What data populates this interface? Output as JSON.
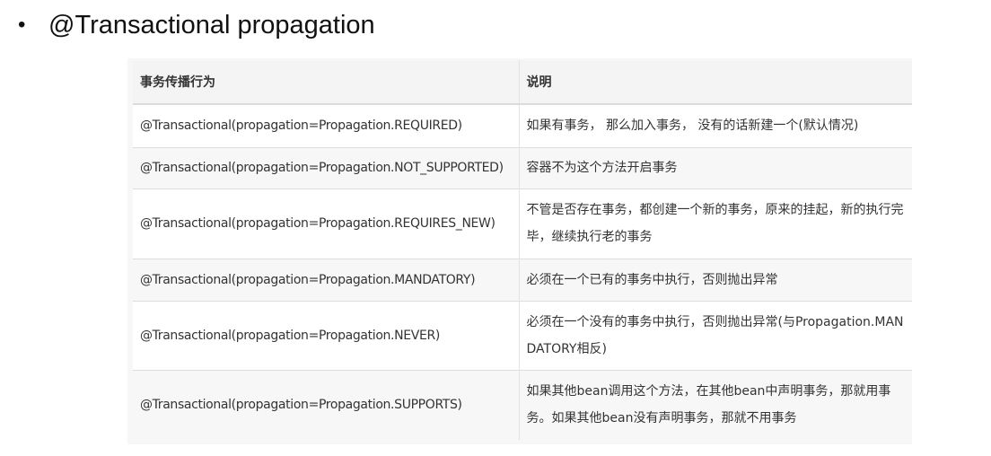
{
  "heading": {
    "bullet": "•",
    "text": "@Transactional propagation"
  },
  "table": {
    "headers": [
      "事务传播行为",
      "说明"
    ],
    "rows": [
      {
        "behavior": "@Transactional(propagation=Propagation.REQUIRED)",
        "description": "如果有事务， 那么加入事务， 没有的话新建一个(默认情况)"
      },
      {
        "behavior": "@Transactional(propagation=Propagation.NOT_SUPPORTED)",
        "description": "容器不为这个方法开启事务"
      },
      {
        "behavior": "@Transactional(propagation=Propagation.REQUIRES_NEW)",
        "description": "不管是否存在事务，都创建一个新的事务，原来的挂起，新的执行完毕，继续执行老的事务"
      },
      {
        "behavior": "@Transactional(propagation=Propagation.MANDATORY)",
        "description": "必须在一个已有的事务中执行，否则抛出异常"
      },
      {
        "behavior": "@Transactional(propagation=Propagation.NEVER)",
        "description": "必须在一个没有的事务中执行，否则抛出异常(与Propagation.MANDATORY相反)"
      },
      {
        "behavior": "@Transactional(propagation=Propagation.SUPPORTS)",
        "description": "如果其他bean调用这个方法，在其他bean中声明事务，那就用事务。如果其他bean没有声明事务，那就不用事务"
      }
    ]
  }
}
